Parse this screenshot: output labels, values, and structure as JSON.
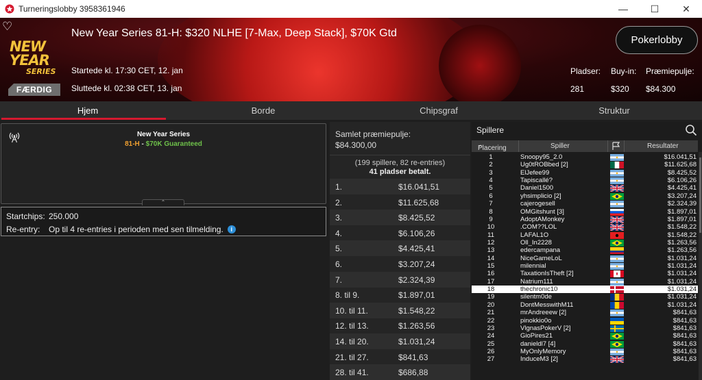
{
  "window": {
    "title": "Turneringslobby 3958361946"
  },
  "header": {
    "tournament_name": "New Year Series 81-H: $320 NLHE [7-Max, Deep Stack], $70K Gtd",
    "brand_line1": "NEW YEAR",
    "brand_line2": "SERIES",
    "status": "FÆRDIG",
    "started": "Startede kl. 17:30 CET, 12. jan",
    "ended": "Sluttede kl. 02:38 CET, 13. jan",
    "lobby_button": "Pokerlobby",
    "stats": [
      {
        "label": "Pladser:",
        "value": "281"
      },
      {
        "label": "Buy-in:",
        "value": "$320"
      },
      {
        "label": "Præmiepulje:",
        "value": "$84.300"
      }
    ]
  },
  "tabs": [
    {
      "label": "Hjem",
      "active": true
    },
    {
      "label": "Borde",
      "active": false
    },
    {
      "label": "Chipsgraf",
      "active": false
    },
    {
      "label": "Struktur",
      "active": false
    }
  ],
  "info": {
    "series_name": "New Year Series",
    "event_code": "81-H",
    "dash": " - ",
    "guarantee": "$70K Guaranteed",
    "startchips_label": "Startchips:",
    "startchips_value": "250.000",
    "reentry_label": "Re-entry:",
    "reentry_value": "Op til 4 re-entries i perioden med sen tilmelding."
  },
  "prizepool": {
    "label": "Samlet præmiepulje:",
    "total": "$84.300,00",
    "players_summary": "(199 spillere, 82 re-entries)",
    "paid": "41 pladser betalt.",
    "rows": [
      {
        "place": "1.",
        "amount": "$16.041,51"
      },
      {
        "place": "2.",
        "amount": "$11.625,68"
      },
      {
        "place": "3.",
        "amount": "$8.425,52"
      },
      {
        "place": "4.",
        "amount": "$6.106,26"
      },
      {
        "place": "5.",
        "amount": "$4.425,41"
      },
      {
        "place": "6.",
        "amount": "$3.207,24"
      },
      {
        "place": "7.",
        "amount": "$2.324,39"
      },
      {
        "place": "8. til 9.",
        "amount": "$1.897,01"
      },
      {
        "place": "10. til 11.",
        "amount": "$1.548,22"
      },
      {
        "place": "12. til 13.",
        "amount": "$1.263,56"
      },
      {
        "place": "14. til 20.",
        "amount": "$1.031,24"
      },
      {
        "place": "21. til 27.",
        "amount": "$841,63"
      },
      {
        "place": "28. til 41.",
        "amount": "$686,88"
      }
    ]
  },
  "players": {
    "title": "Spillere",
    "col_place": "Placering",
    "col_player": "Spiller",
    "col_results": "Resultater",
    "highlight_place": "18",
    "rows": [
      {
        "place": "1",
        "name": "Snoopy95_2.0",
        "result": "$16.041,51",
        "flag": "ar"
      },
      {
        "place": "2",
        "name": "Ug0tROBbed [2]",
        "result": "$11.625,68",
        "flag": "mx"
      },
      {
        "place": "3",
        "name": "ElJefee99",
        "result": "$8.425,52",
        "flag": "ar"
      },
      {
        "place": "4",
        "name": "Tapiscallé?",
        "result": "$6.106,26",
        "flag": "ar"
      },
      {
        "place": "5",
        "name": "Daniel1500",
        "result": "$4.425,41",
        "flag": "gb"
      },
      {
        "place": "6",
        "name": "yhsimplicio [2]",
        "result": "$3.207,24",
        "flag": "br"
      },
      {
        "place": "7",
        "name": "cajerogesell",
        "result": "$2.324,39",
        "flag": "ar"
      },
      {
        "place": "8",
        "name": "OMGitshunt [3]",
        "result": "$1.897,01",
        "flag": "si"
      },
      {
        "place": "9",
        "name": "AdoptAMonkey",
        "result": "$1.897,01",
        "flag": "gb"
      },
      {
        "place": "10",
        "name": ".COM??LOL",
        "result": "$1.548,22",
        "flag": "gb"
      },
      {
        "place": "11",
        "name": "LAFAL1O",
        "result": "$1.548,22",
        "flag": "al"
      },
      {
        "place": "12",
        "name": "Oll_In2228",
        "result": "$1.263,56",
        "flag": "br"
      },
      {
        "place": "13",
        "name": "edercampana",
        "result": "$1.263,56",
        "flag": "co"
      },
      {
        "place": "14",
        "name": "NiceGameLoL",
        "result": "$1.031,24",
        "flag": "ar"
      },
      {
        "place": "15",
        "name": "milennial",
        "result": "$1.031,24",
        "flag": "ar"
      },
      {
        "place": "16",
        "name": "TaxationIsTheft [2]",
        "result": "$1.031,24",
        "flag": "ca"
      },
      {
        "place": "17",
        "name": "Natrium111",
        "result": "$1.031,24",
        "flag": "ar"
      },
      {
        "place": "18",
        "name": "thechronic10",
        "result": "$1.031,24",
        "flag": "dk"
      },
      {
        "place": "19",
        "name": "silentm0de",
        "result": "$1.031,24",
        "flag": "ro"
      },
      {
        "place": "20",
        "name": "DontMesswithM11",
        "result": "$1.031,24",
        "flag": "md"
      },
      {
        "place": "21",
        "name": "mrAndreeew [2]",
        "result": "$841,63",
        "flag": "ar"
      },
      {
        "place": "22",
        "name": "pinokkio0o",
        "result": "$841,63",
        "flag": "ua"
      },
      {
        "place": "23",
        "name": "VlgnasPokerV [2]",
        "result": "$841,63",
        "flag": "se"
      },
      {
        "place": "24",
        "name": "GioPires21",
        "result": "$841,63",
        "flag": "br"
      },
      {
        "place": "25",
        "name": "danieldl7 [4]",
        "result": "$841,63",
        "flag": "br"
      },
      {
        "place": "26",
        "name": "MyOnlyMemory",
        "result": "$841,63",
        "flag": "ar"
      },
      {
        "place": "27",
        "name": "InduceM3 [2]",
        "result": "$841,63",
        "flag": "gb"
      }
    ]
  },
  "colors": {
    "accent_red": "#d5192f",
    "event_orange": "#f0a030",
    "guarantee_green": "#6ec14a",
    "info_blue": "#2d8fd8"
  }
}
